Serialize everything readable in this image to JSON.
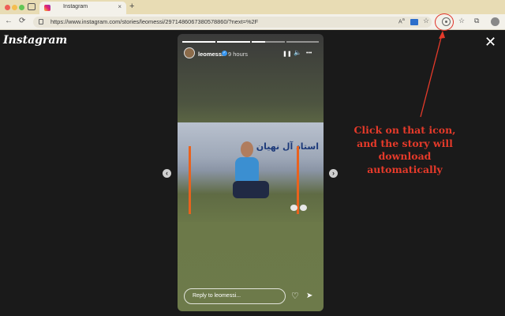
{
  "browser": {
    "tab_title": "Instagram",
    "tab_close": "×",
    "new_tab": "+",
    "url": "https://www.instagram.com/stories/leomessi/2971486067380578860/?next=%2F",
    "nav": {
      "back": "←",
      "reload": "⟳"
    },
    "toolbar_icons": [
      "read-aloud-icon",
      "translate-icon",
      "favorite-add-icon",
      "story-download-extension-icon",
      "favorites-icon",
      "collections-icon",
      "profile-icon"
    ]
  },
  "instagram": {
    "logo": "Instagram",
    "close": "✕",
    "prev": "‹",
    "next": "›"
  },
  "story": {
    "username": "leomessi",
    "verified": "✓",
    "time": "9 hours",
    "controls": {
      "pause": "❚❚",
      "mute": "🔈",
      "more": "•••"
    },
    "progress": [
      1.0,
      1.0,
      0.4,
      0.0
    ],
    "photo_text": "استاد آل نهيان",
    "reply_placeholder": "Reply to leomessi...",
    "like": "♡",
    "share": "➤"
  },
  "annotation": {
    "lines": [
      "Click on that icon,",
      "and the story will",
      "download",
      "automatically"
    ],
    "color": "#e53a2a"
  }
}
